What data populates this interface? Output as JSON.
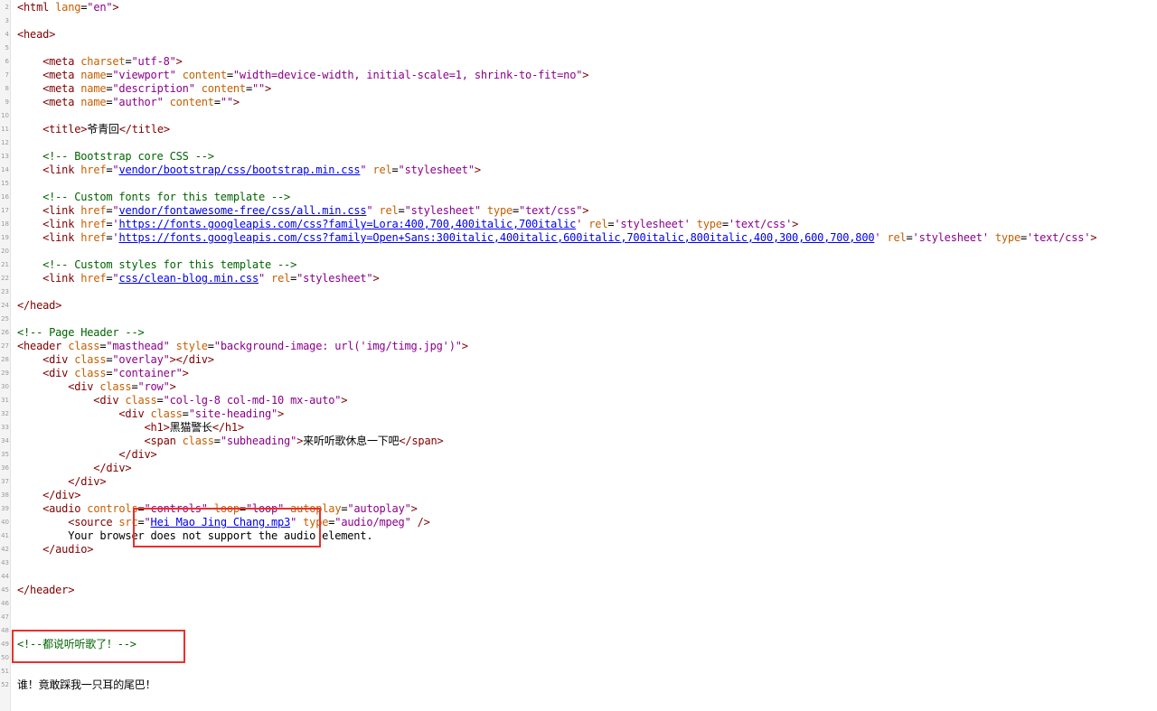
{
  "colors": {
    "tag": "#800000",
    "attribute": "#c65f00",
    "value": "#8b008b",
    "comment": "#006400",
    "link": "#0000ee",
    "highlight_box": "#e8312d"
  },
  "lines": [
    {
      "n": "2",
      "segs": [
        [
          "t",
          "<html "
        ],
        [
          "a",
          "lang"
        ],
        [
          "p",
          "="
        ],
        [
          "v",
          "\"en\""
        ],
        [
          "t",
          ">"
        ]
      ]
    },
    {
      "n": "3",
      "segs": []
    },
    {
      "n": "4",
      "segs": [
        [
          "t",
          "<head>"
        ]
      ]
    },
    {
      "n": "5",
      "segs": []
    },
    {
      "n": "6",
      "segs": [
        [
          "p",
          "    "
        ],
        [
          "t",
          "<meta "
        ],
        [
          "a",
          "charset"
        ],
        [
          "p",
          "="
        ],
        [
          "v",
          "\"utf-8\""
        ],
        [
          "t",
          ">"
        ]
      ]
    },
    {
      "n": "7",
      "segs": [
        [
          "p",
          "    "
        ],
        [
          "t",
          "<meta "
        ],
        [
          "a",
          "name"
        ],
        [
          "p",
          "="
        ],
        [
          "v",
          "\"viewport\""
        ],
        [
          "p",
          " "
        ],
        [
          "a",
          "content"
        ],
        [
          "p",
          "="
        ],
        [
          "v",
          "\"width=device-width, initial-scale=1, shrink-to-fit=no\""
        ],
        [
          "t",
          ">"
        ]
      ]
    },
    {
      "n": "8",
      "segs": [
        [
          "p",
          "    "
        ],
        [
          "t",
          "<meta "
        ],
        [
          "a",
          "name"
        ],
        [
          "p",
          "="
        ],
        [
          "v",
          "\"description\""
        ],
        [
          "p",
          " "
        ],
        [
          "a",
          "content"
        ],
        [
          "p",
          "="
        ],
        [
          "v",
          "\"\""
        ],
        [
          "t",
          ">"
        ]
      ]
    },
    {
      "n": "9",
      "segs": [
        [
          "p",
          "    "
        ],
        [
          "t",
          "<meta "
        ],
        [
          "a",
          "name"
        ],
        [
          "p",
          "="
        ],
        [
          "v",
          "\"author\""
        ],
        [
          "p",
          " "
        ],
        [
          "a",
          "content"
        ],
        [
          "p",
          "="
        ],
        [
          "v",
          "\"\""
        ],
        [
          "t",
          ">"
        ]
      ]
    },
    {
      "n": "10",
      "segs": []
    },
    {
      "n": "11",
      "segs": [
        [
          "p",
          "    "
        ],
        [
          "t",
          "<title>"
        ],
        [
          "p",
          "爷青回"
        ],
        [
          "t",
          "</title>"
        ]
      ]
    },
    {
      "n": "12",
      "segs": []
    },
    {
      "n": "13",
      "segs": [
        [
          "p",
          "    "
        ],
        [
          "c",
          "<!-- Bootstrap core CSS -->"
        ]
      ]
    },
    {
      "n": "14",
      "segs": [
        [
          "p",
          "    "
        ],
        [
          "t",
          "<link "
        ],
        [
          "a",
          "href"
        ],
        [
          "p",
          "="
        ],
        [
          "v",
          "\""
        ],
        [
          "l",
          "vendor/bootstrap/css/bootstrap.min.css"
        ],
        [
          "v",
          "\""
        ],
        [
          "p",
          " "
        ],
        [
          "a",
          "rel"
        ],
        [
          "p",
          "="
        ],
        [
          "v",
          "\"stylesheet\""
        ],
        [
          "t",
          ">"
        ]
      ]
    },
    {
      "n": "15",
      "segs": []
    },
    {
      "n": "16",
      "segs": [
        [
          "p",
          "    "
        ],
        [
          "c",
          "<!-- Custom fonts for this template -->"
        ]
      ]
    },
    {
      "n": "17",
      "segs": [
        [
          "p",
          "    "
        ],
        [
          "t",
          "<link "
        ],
        [
          "a",
          "href"
        ],
        [
          "p",
          "="
        ],
        [
          "v",
          "\""
        ],
        [
          "l",
          "vendor/fontawesome-free/css/all.min.css"
        ],
        [
          "v",
          "\""
        ],
        [
          "p",
          " "
        ],
        [
          "a",
          "rel"
        ],
        [
          "p",
          "="
        ],
        [
          "v",
          "\"stylesheet\""
        ],
        [
          "p",
          " "
        ],
        [
          "a",
          "type"
        ],
        [
          "p",
          "="
        ],
        [
          "v",
          "\"text/css\""
        ],
        [
          "t",
          ">"
        ]
      ]
    },
    {
      "n": "18",
      "segs": [
        [
          "p",
          "    "
        ],
        [
          "t",
          "<link "
        ],
        [
          "a",
          "href"
        ],
        [
          "p",
          "="
        ],
        [
          "v",
          "'"
        ],
        [
          "l",
          "https://fonts.googleapis.com/css?family=Lora:400,700,400italic,700italic"
        ],
        [
          "v",
          "'"
        ],
        [
          "p",
          " "
        ],
        [
          "a",
          "rel"
        ],
        [
          "p",
          "="
        ],
        [
          "v",
          "'stylesheet'"
        ],
        [
          "p",
          " "
        ],
        [
          "a",
          "type"
        ],
        [
          "p",
          "="
        ],
        [
          "v",
          "'text/css'"
        ],
        [
          "t",
          ">"
        ]
      ]
    },
    {
      "n": "19",
      "segs": [
        [
          "p",
          "    "
        ],
        [
          "t",
          "<link "
        ],
        [
          "a",
          "href"
        ],
        [
          "p",
          "="
        ],
        [
          "v",
          "'"
        ],
        [
          "l",
          "https://fonts.googleapis.com/css?family=Open+Sans:300italic,400italic,600italic,700italic,800italic,400,300,600,700,800"
        ],
        [
          "v",
          "'"
        ],
        [
          "p",
          " "
        ],
        [
          "a",
          "rel"
        ],
        [
          "p",
          "="
        ],
        [
          "v",
          "'stylesheet'"
        ],
        [
          "p",
          " "
        ],
        [
          "a",
          "type"
        ],
        [
          "p",
          "="
        ],
        [
          "v",
          "'text/css'"
        ],
        [
          "t",
          ">"
        ]
      ]
    },
    {
      "n": "20",
      "segs": []
    },
    {
      "n": "21",
      "segs": [
        [
          "p",
          "    "
        ],
        [
          "c",
          "<!-- Custom styles for this template -->"
        ]
      ]
    },
    {
      "n": "22",
      "segs": [
        [
          "p",
          "    "
        ],
        [
          "t",
          "<link "
        ],
        [
          "a",
          "href"
        ],
        [
          "p",
          "="
        ],
        [
          "v",
          "\""
        ],
        [
          "l",
          "css/clean-blog.min.css"
        ],
        [
          "v",
          "\""
        ],
        [
          "p",
          " "
        ],
        [
          "a",
          "rel"
        ],
        [
          "p",
          "="
        ],
        [
          "v",
          "\"stylesheet\""
        ],
        [
          "t",
          ">"
        ]
      ]
    },
    {
      "n": "23",
      "segs": []
    },
    {
      "n": "24",
      "segs": [
        [
          "t",
          "</head>"
        ]
      ]
    },
    {
      "n": "25",
      "segs": []
    },
    {
      "n": "26",
      "segs": [
        [
          "c",
          "<!-- Page Header -->"
        ]
      ]
    },
    {
      "n": "27",
      "segs": [
        [
          "t",
          "<header "
        ],
        [
          "a",
          "class"
        ],
        [
          "p",
          "="
        ],
        [
          "v",
          "\"masthead\""
        ],
        [
          "p",
          " "
        ],
        [
          "a",
          "style"
        ],
        [
          "p",
          "="
        ],
        [
          "v",
          "\"background-image: url('img/timg.jpg')\""
        ],
        [
          "t",
          ">"
        ]
      ]
    },
    {
      "n": "28",
      "segs": [
        [
          "p",
          "    "
        ],
        [
          "t",
          "<div "
        ],
        [
          "a",
          "class"
        ],
        [
          "p",
          "="
        ],
        [
          "v",
          "\"overlay\""
        ],
        [
          "t",
          "></div>"
        ]
      ]
    },
    {
      "n": "29",
      "segs": [
        [
          "p",
          "    "
        ],
        [
          "t",
          "<div "
        ],
        [
          "a",
          "class"
        ],
        [
          "p",
          "="
        ],
        [
          "v",
          "\"container\""
        ],
        [
          "t",
          ">"
        ]
      ]
    },
    {
      "n": "30",
      "segs": [
        [
          "p",
          "        "
        ],
        [
          "t",
          "<div "
        ],
        [
          "a",
          "class"
        ],
        [
          "p",
          "="
        ],
        [
          "v",
          "\"row\""
        ],
        [
          "t",
          ">"
        ]
      ]
    },
    {
      "n": "31",
      "segs": [
        [
          "p",
          "            "
        ],
        [
          "t",
          "<div "
        ],
        [
          "a",
          "class"
        ],
        [
          "p",
          "="
        ],
        [
          "v",
          "\"col-lg-8 col-md-10 mx-auto\""
        ],
        [
          "t",
          ">"
        ]
      ]
    },
    {
      "n": "32",
      "segs": [
        [
          "p",
          "                "
        ],
        [
          "t",
          "<div "
        ],
        [
          "a",
          "class"
        ],
        [
          "p",
          "="
        ],
        [
          "v",
          "\"site-heading\""
        ],
        [
          "t",
          ">"
        ]
      ]
    },
    {
      "n": "33",
      "segs": [
        [
          "p",
          "                    "
        ],
        [
          "t",
          "<h1>"
        ],
        [
          "p",
          "黑猫警长"
        ],
        [
          "t",
          "</h1>"
        ]
      ]
    },
    {
      "n": "34",
      "segs": [
        [
          "p",
          "                    "
        ],
        [
          "t",
          "<span "
        ],
        [
          "a",
          "class"
        ],
        [
          "p",
          "="
        ],
        [
          "v",
          "\"subheading\""
        ],
        [
          "t",
          ">"
        ],
        [
          "p",
          "来听听歌休息一下吧"
        ],
        [
          "t",
          "</span>"
        ]
      ]
    },
    {
      "n": "35",
      "segs": [
        [
          "p",
          "                "
        ],
        [
          "t",
          "</div>"
        ]
      ]
    },
    {
      "n": "36",
      "segs": [
        [
          "p",
          "            "
        ],
        [
          "t",
          "</div>"
        ]
      ]
    },
    {
      "n": "37",
      "segs": [
        [
          "p",
          "        "
        ],
        [
          "t",
          "</div>"
        ]
      ]
    },
    {
      "n": "38",
      "segs": [
        [
          "p",
          "    "
        ],
        [
          "t",
          "</div>"
        ]
      ]
    },
    {
      "n": "39",
      "segs": [
        [
          "p",
          "    "
        ],
        [
          "t",
          "<audio "
        ],
        [
          "a",
          "controls"
        ],
        [
          "p",
          "="
        ],
        [
          "v",
          "\"controls\""
        ],
        [
          "p",
          " "
        ],
        [
          "a",
          "loop"
        ],
        [
          "p",
          "="
        ],
        [
          "v",
          "\"loop\""
        ],
        [
          "p",
          " "
        ],
        [
          "a",
          "autoplay"
        ],
        [
          "p",
          "="
        ],
        [
          "v",
          "\"autoplay\""
        ],
        [
          "t",
          ">"
        ]
      ]
    },
    {
      "n": "40",
      "segs": [
        [
          "p",
          "        "
        ],
        [
          "t",
          "<source "
        ],
        [
          "a",
          "src"
        ],
        [
          "p",
          "="
        ],
        [
          "v",
          "\""
        ],
        [
          "l",
          "Hei Mao Jing Chang.mp3"
        ],
        [
          "v",
          "\""
        ],
        [
          "p",
          " "
        ],
        [
          "a",
          "type"
        ],
        [
          "p",
          "="
        ],
        [
          "v",
          "\"audio/mpeg\""
        ],
        [
          "p",
          " "
        ],
        [
          "t",
          "/>"
        ]
      ]
    },
    {
      "n": "41",
      "segs": [
        [
          "p",
          "        Your browser does not support the audio element."
        ]
      ]
    },
    {
      "n": "42",
      "segs": [
        [
          "p",
          "    "
        ],
        [
          "t",
          "</audio>"
        ]
      ]
    },
    {
      "n": "43",
      "segs": []
    },
    {
      "n": "44",
      "segs": []
    },
    {
      "n": "45",
      "segs": [
        [
          "t",
          "</header>"
        ]
      ]
    },
    {
      "n": "46",
      "segs": []
    },
    {
      "n": "47",
      "segs": []
    },
    {
      "n": "48",
      "segs": []
    },
    {
      "n": "49",
      "segs": [
        [
          "c",
          "<!--都说听听歌了！-->"
        ]
      ]
    },
    {
      "n": "50",
      "segs": []
    },
    {
      "n": "51",
      "segs": []
    },
    {
      "n": "52",
      "segs": [
        [
          "p",
          "谁！竟敢踩我一只耳的尾巴！"
        ]
      ]
    }
  ]
}
